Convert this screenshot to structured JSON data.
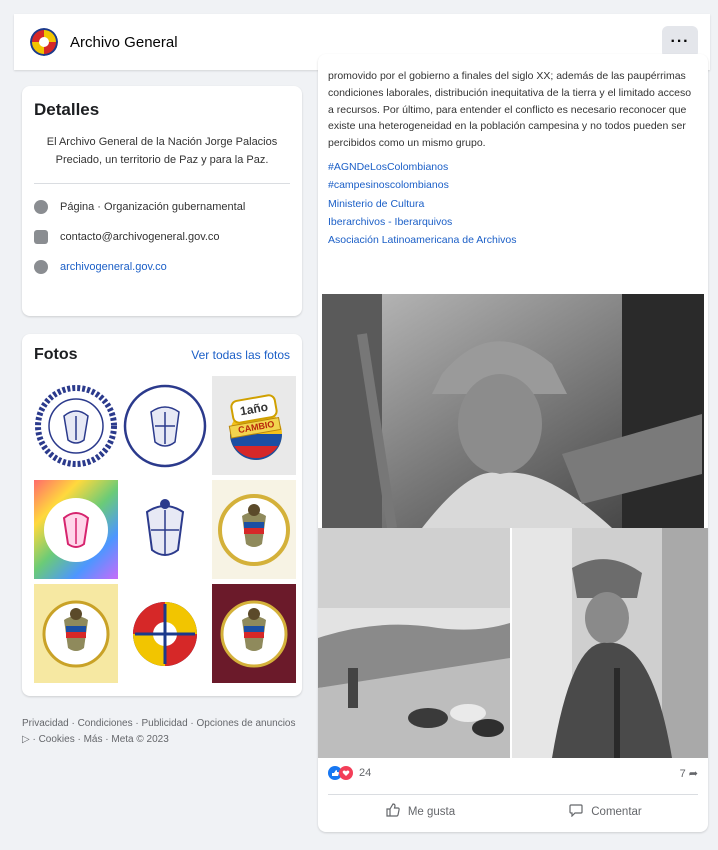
{
  "header": {
    "title": "Archivo General",
    "more_label": "···"
  },
  "details": {
    "heading": "Detalles",
    "description": "El Archivo General de la Nación Jorge Palacios Preciado, un territorio de Paz y para la Paz.",
    "category": "Página · Organización gubernamental",
    "email": "contacto@archivogeneral.gov.co",
    "website": "archivogeneral.gov.co"
  },
  "photos": {
    "heading": "Fotos",
    "see_all": "Ver todas las fotos",
    "tile3_text": "1año",
    "tile3_banner": "CAMBIO"
  },
  "footer": {
    "line1": "Privacidad · Condiciones · Publicidad · Opciones de anuncios",
    "line2": "▷ · Cookies · Más · Meta © 2023"
  },
  "post": {
    "body": "promovido por el gobierno a finales del siglo XX; además de las paupérrimas condiciones laborales, distribución inequitativa de la tierra y el limitado acceso a recursos. Por último, para entender el conflicto es necesario reconocer que existe una heterogeneidad en la población campesina y no todos pueden ser percibidos como un mismo grupo.",
    "tags": [
      "#AGNDeLosColombianos",
      "#campesinoscolombianos",
      "Ministerio de Cultura",
      "Iberarchivos - Iberarquivos",
      "Asociación Latinoamericana de Archivos"
    ],
    "reactions_count": "24",
    "shares_count": "7",
    "like_label": "Me gusta",
    "comment_label": "Comentar"
  },
  "colors": {
    "link": "#1b5fc7",
    "like_blue": "#1877f2",
    "love_red": "#f33e58",
    "maroon": "#6b1a2a"
  }
}
